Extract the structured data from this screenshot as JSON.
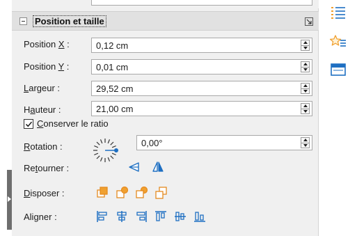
{
  "panel": {
    "title": "Position et taille"
  },
  "fields": {
    "pos_x": {
      "label_pre": "Position ",
      "label_key": "X",
      "label_post": " :",
      "value": "0,12 cm"
    },
    "pos_y": {
      "label_pre": "Position ",
      "label_key": "Y",
      "label_post": " :",
      "value": "0,01 cm"
    },
    "width": {
      "label_pre": "",
      "label_key": "L",
      "label_post": "argeur :",
      "value": "29,52 cm"
    },
    "height": {
      "label_pre": "H",
      "label_key": "a",
      "label_post": "uteur :",
      "value": "21,00 cm"
    }
  },
  "keep_ratio": {
    "label_key": "C",
    "label_post": "onserver le ratio",
    "checked": true
  },
  "rotation": {
    "label_key": "R",
    "label_post": "otation :",
    "value": "0,00°"
  },
  "flip": {
    "label_pre": "Re",
    "label_key": "t",
    "label_post": "ourner :",
    "icons": [
      "flip-vertical-icon",
      "flip-horizontal-icon"
    ]
  },
  "arrange": {
    "label_key": "D",
    "label_post": "isposer :",
    "icons": [
      "bring-to-front-icon",
      "bring-forward-icon",
      "send-backward-icon",
      "send-to-back-icon"
    ]
  },
  "align": {
    "label": "Aligner :",
    "icons": [
      "align-left-icon",
      "align-center-icon",
      "align-right-icon",
      "align-top-icon",
      "align-middle-icon",
      "align-bottom-icon"
    ]
  },
  "sidebar_tabs": [
    "properties-icon",
    "styles-icon",
    "gallery-icon"
  ],
  "colors": {
    "accent": "#1e6fc2",
    "icon_orange": "#f0a030",
    "deck_bg": "#f0f0f0",
    "header_bg": "#e1e1e1"
  }
}
